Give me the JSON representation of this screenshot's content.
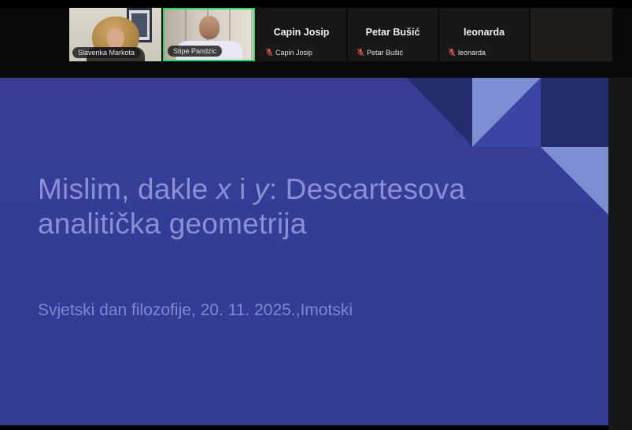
{
  "app": {
    "kind": "video-conference-screen-share"
  },
  "filmstrip": {
    "participants": [
      {
        "name": "Slavenka Markota",
        "type": "video",
        "muted": false,
        "active_speaker": false
      },
      {
        "name": "Stipe Pandzic",
        "type": "video",
        "muted": false,
        "active_speaker": true
      },
      {
        "name": "Capin Josip",
        "type": "audio",
        "muted": true,
        "active_speaker": false
      },
      {
        "name": "Petar Bušić",
        "type": "audio",
        "muted": true,
        "active_speaker": false
      },
      {
        "name": "leonarda",
        "type": "audio",
        "muted": true,
        "active_speaker": false
      }
    ]
  },
  "slide": {
    "title_line1": {
      "pre": "Mislim, dakle ",
      "var1": "x",
      "mid": " i ",
      "var2": "y",
      "post": ": Descartesova"
    },
    "title_line2": "analitička geometrija",
    "subtitle": "Svjetski dan filozofije, 20. 11. 2025.,Imotski"
  },
  "colors": {
    "slide_bg": "#343d96",
    "title_text": "#8a90d6",
    "subtitle_text": "#8187cf",
    "accent_dark": "#242d6e",
    "accent_light": "#7e8ed3",
    "accent_mid": "#3a45a4",
    "active_green": "#2bd46b",
    "mic_red": "#d9574d"
  }
}
